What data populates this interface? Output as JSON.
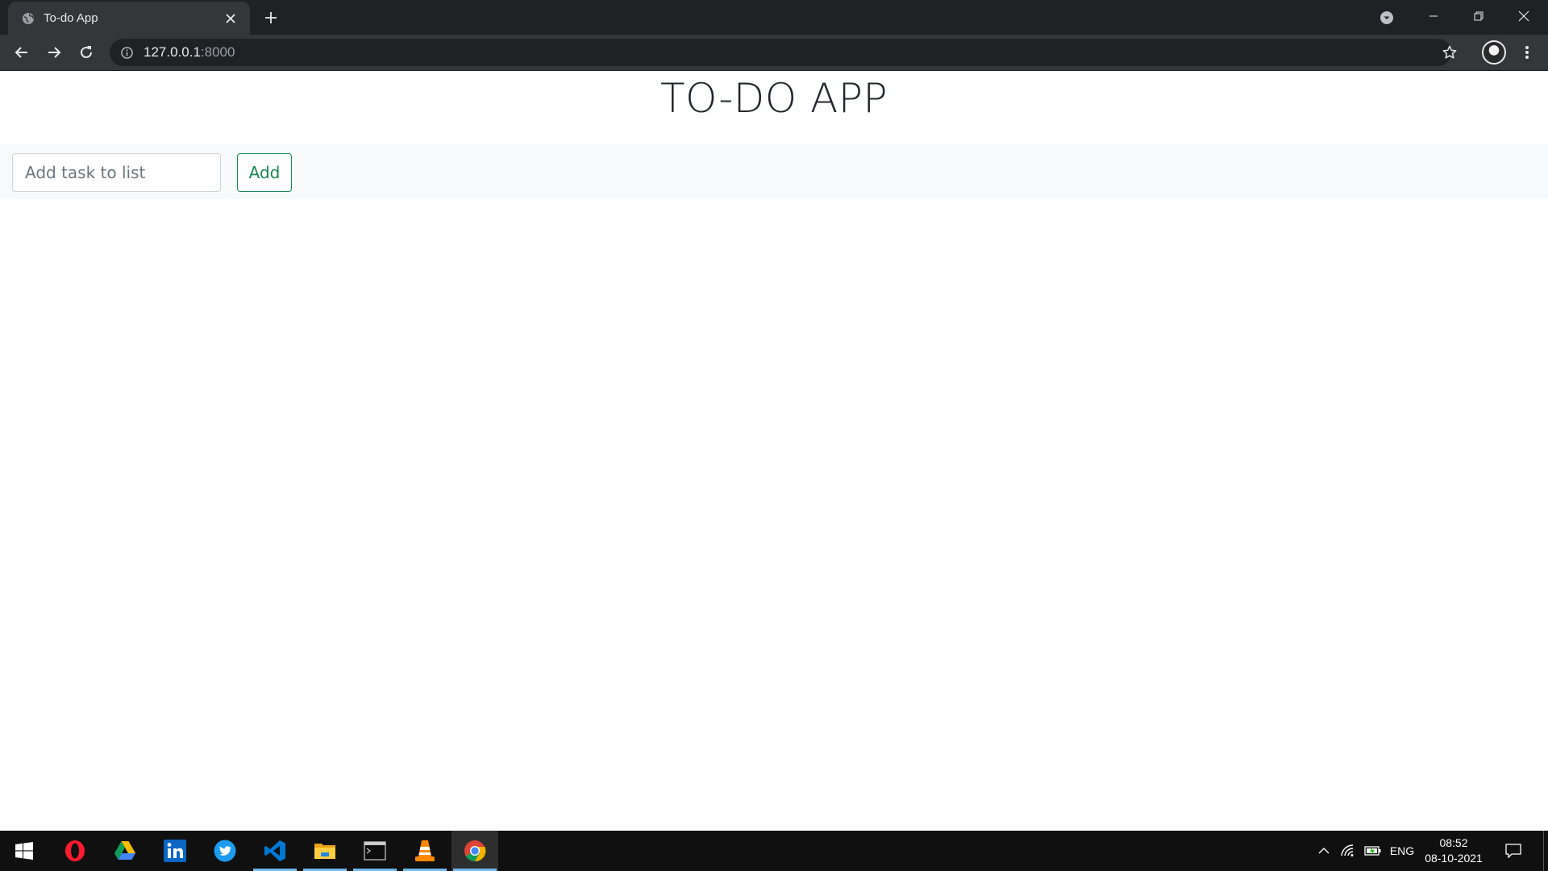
{
  "browser": {
    "tab": {
      "title": "To-do App"
    },
    "address": {
      "host": "127.0.0.1",
      "port": ":8000"
    }
  },
  "page": {
    "heading": "TO-DO APP",
    "form": {
      "task_placeholder": "Add task to list",
      "task_value": "",
      "add_label": "Add"
    }
  },
  "taskbar": {
    "pinned": [
      "windows-start",
      "opera",
      "google-drive",
      "linkedin",
      "twitter",
      "visual-studio-code",
      "file-explorer",
      "terminal",
      "vlc",
      "chrome"
    ],
    "language": "ENG",
    "time": "08:52",
    "date": "08-10-2021"
  },
  "colors": {
    "accent_green": "#198754",
    "chrome_dark": "#202124",
    "chrome_mid": "#35363a"
  }
}
